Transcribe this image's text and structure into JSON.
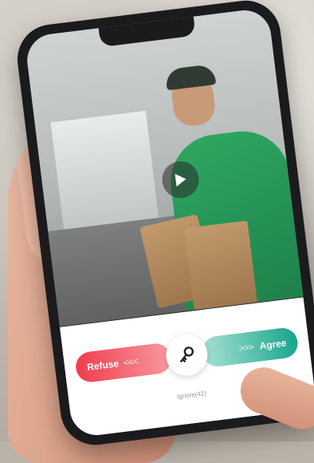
{
  "video": {
    "play_icon": "play-icon"
  },
  "call_panel": {
    "refuse_label": "Refuse",
    "refuse_chevrons": "<<<",
    "agree_label": "Agree",
    "agree_chevrons": ">>>",
    "center_icon": "key-icon",
    "ignore_text": "Ignore(42)",
    "colors": {
      "refuse": "#f03c4c",
      "agree": "#17a58a"
    }
  }
}
